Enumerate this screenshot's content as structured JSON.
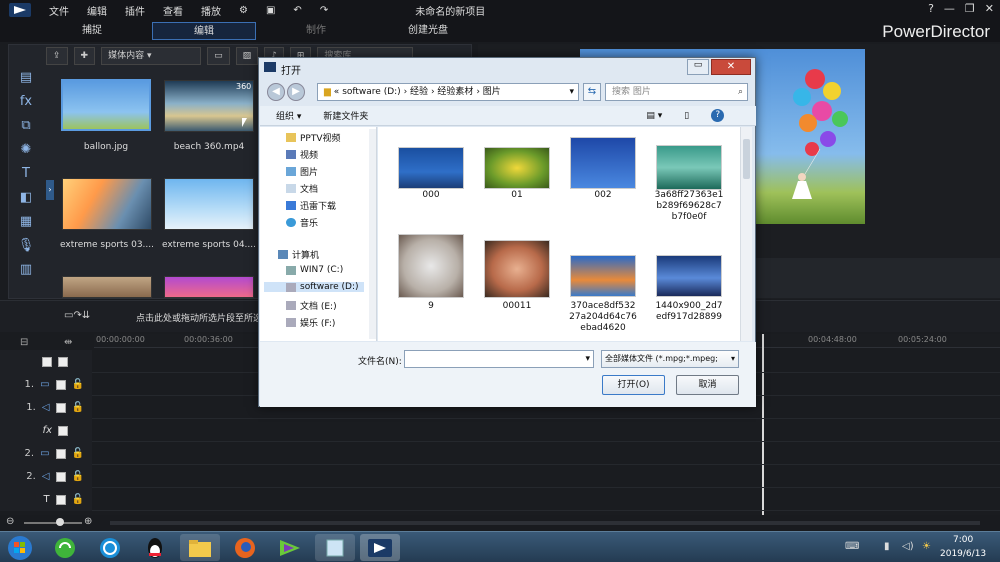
{
  "menu": {
    "items": [
      "文件",
      "编辑",
      "插件",
      "查看",
      "播放"
    ]
  },
  "window": {
    "title": "未命名的新项目",
    "brand": "PowerDirector"
  },
  "modes": [
    "捕捉",
    "编辑",
    "制作",
    "创建光盘"
  ],
  "library": {
    "dropdown": "媒体内容",
    "search_placeholder": "搜索库",
    "items": [
      {
        "name": "ballon.jpg"
      },
      {
        "name": "beach 360.mp4",
        "badge": "360"
      },
      {
        "name": "extreme sports 03...."
      },
      {
        "name": "extreme sports 04...."
      }
    ]
  },
  "timeline": {
    "hint": "点击此处或拖动所选片段至所选",
    "times": [
      "00:00:00:00",
      "00:00:36:00",
      "00:04:48:00",
      "00:05:24:00"
    ],
    "tracks": [
      "",
      "1.",
      "1.",
      "",
      "2.",
      "2.",
      ""
    ]
  },
  "dialog": {
    "title": "打开",
    "path": [
      "«",
      "software (D:)",
      "›",
      "经验",
      "›",
      "经验素材",
      "›",
      "图片"
    ],
    "search_placeholder": "搜索 图片",
    "organize": "组织 ▾",
    "new_folder": "新建文件夹",
    "tree": [
      "PPTV视频",
      "视频",
      "图片",
      "文档",
      "迅雷下载",
      "音乐",
      "计算机",
      "WIN7 (C:)",
      "software (D:)",
      "文档 (E:)",
      "娱乐 (F:)"
    ],
    "files": [
      "000",
      "01",
      "002",
      "3a68ff27363e1b289f69628c7b7f0e0f",
      "9",
      "00011",
      "370ace8df53227a204d64c76ebad4620",
      "1440x900_2d7edf917d28899"
    ],
    "filename_label": "文件名(N):",
    "filename_value": "",
    "filter": "全部媒体文件 (*.mpg;*.mpeg;",
    "open_label": "打开(O)",
    "cancel_label": "取消"
  },
  "clock": {
    "time": "7:00",
    "date": "2019/6/13"
  }
}
